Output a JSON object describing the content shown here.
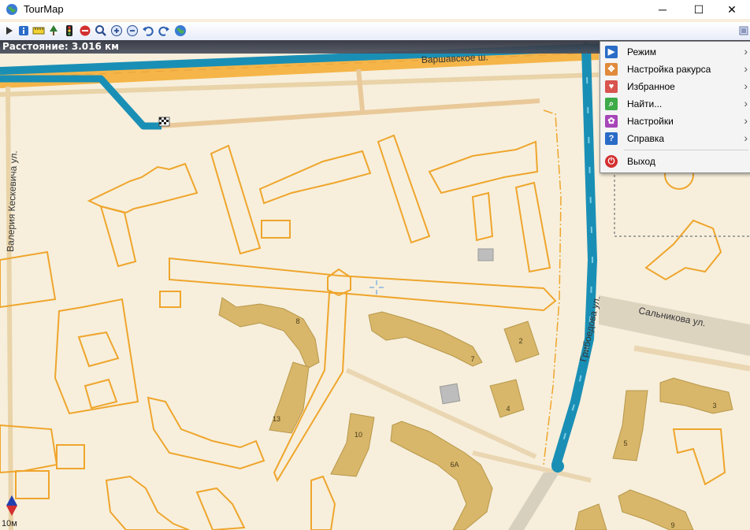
{
  "window": {
    "title": "TourMap",
    "controls": [
      "─",
      "☐",
      "✕"
    ]
  },
  "toolbar": {
    "icons": [
      "play-icon",
      "info-icon",
      "ruler-icon",
      "tree-icon",
      "traffic-light-icon",
      "stop-icon",
      "search-icon",
      "zoom-in-icon",
      "zoom-out-icon",
      "undo-icon",
      "redo-icon",
      "globe-icon"
    ]
  },
  "status": {
    "distance": "Расстояние: 3.016 км"
  },
  "map": {
    "streets": {
      "varshavskoe": "Варшавское ш.",
      "keskevicha": "Валерия Кескевича ул.",
      "griboedova": "Грибоедова ул.",
      "salnikova": "Сальникова ул."
    },
    "house_numbers": [
      "8",
      "13",
      "10",
      "2",
      "7",
      "4",
      "6А",
      "3",
      "5",
      "9"
    ],
    "scale": "10м"
  },
  "menu": {
    "items": [
      {
        "label": "Режим",
        "submenu": true
      },
      {
        "label": "Настройка ракурса",
        "submenu": true
      },
      {
        "label": "Избранное",
        "submenu": true
      },
      {
        "label": "Найти...",
        "submenu": true
      },
      {
        "label": "Настройки",
        "submenu": true
      },
      {
        "label": "Справка",
        "submenu": true
      },
      {
        "label": "Выход",
        "submenu": false
      }
    ],
    "arrow": "›"
  },
  "colors": {
    "route": "#1a8fb5",
    "road_major": "#f5b548",
    "building": "#d8b76a",
    "outline": "#efa52c",
    "background": "#f7efdc"
  }
}
